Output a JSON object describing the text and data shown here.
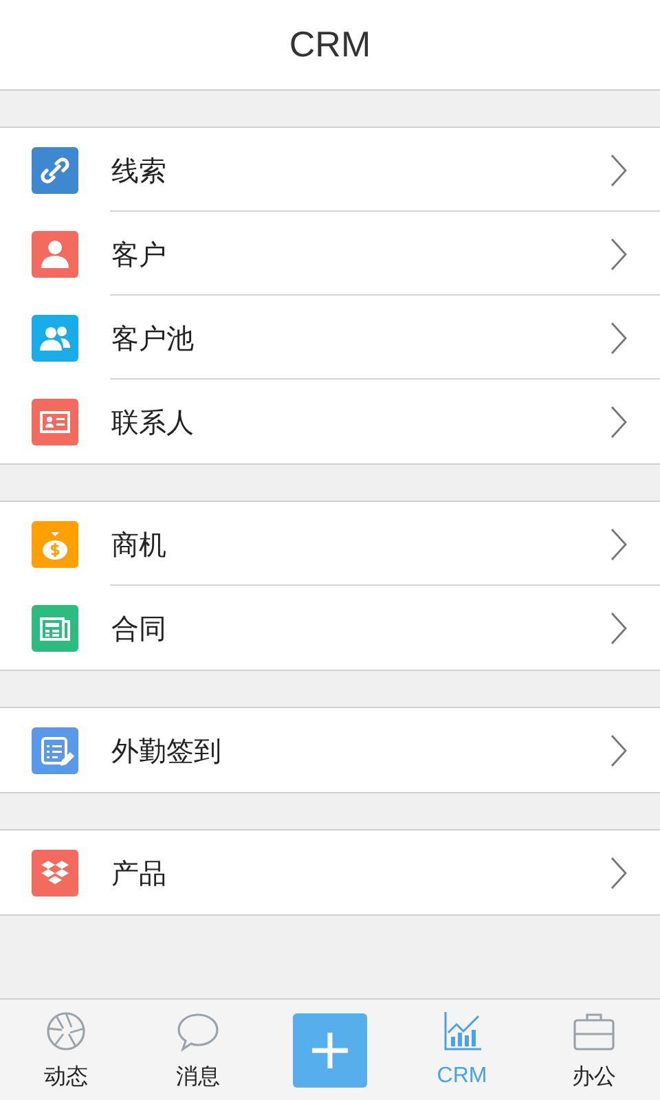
{
  "header": {
    "title": "CRM"
  },
  "groups": [
    {
      "items": [
        {
          "label": "线索",
          "kind": "link",
          "color": "#3f88d0"
        },
        {
          "label": "客户",
          "kind": "person",
          "color": "#f26b5e"
        },
        {
          "label": "客户池",
          "kind": "people",
          "color": "#1aace8"
        },
        {
          "label": "联系人",
          "kind": "card",
          "color": "#f26b5e"
        }
      ]
    },
    {
      "items": [
        {
          "label": "商机",
          "kind": "money",
          "color": "#ffa000"
        },
        {
          "label": "合同",
          "kind": "contract",
          "color": "#2dbb80"
        }
      ]
    },
    {
      "items": [
        {
          "label": "外勤签到",
          "kind": "checkin",
          "color": "#5a98ea"
        }
      ]
    },
    {
      "items": [
        {
          "label": "产品",
          "kind": "product",
          "color": "#f26b5e"
        }
      ]
    }
  ],
  "tab_bar": [
    {
      "kind": "tab",
      "label": "动态",
      "selected": false
    },
    {
      "kind": "tab",
      "label": "消息",
      "selected": false
    },
    {
      "kind": "add"
    },
    {
      "kind": "tab",
      "label": "CRM",
      "selected": true
    },
    {
      "kind": "tab",
      "label": "办公",
      "selected": false
    }
  ]
}
